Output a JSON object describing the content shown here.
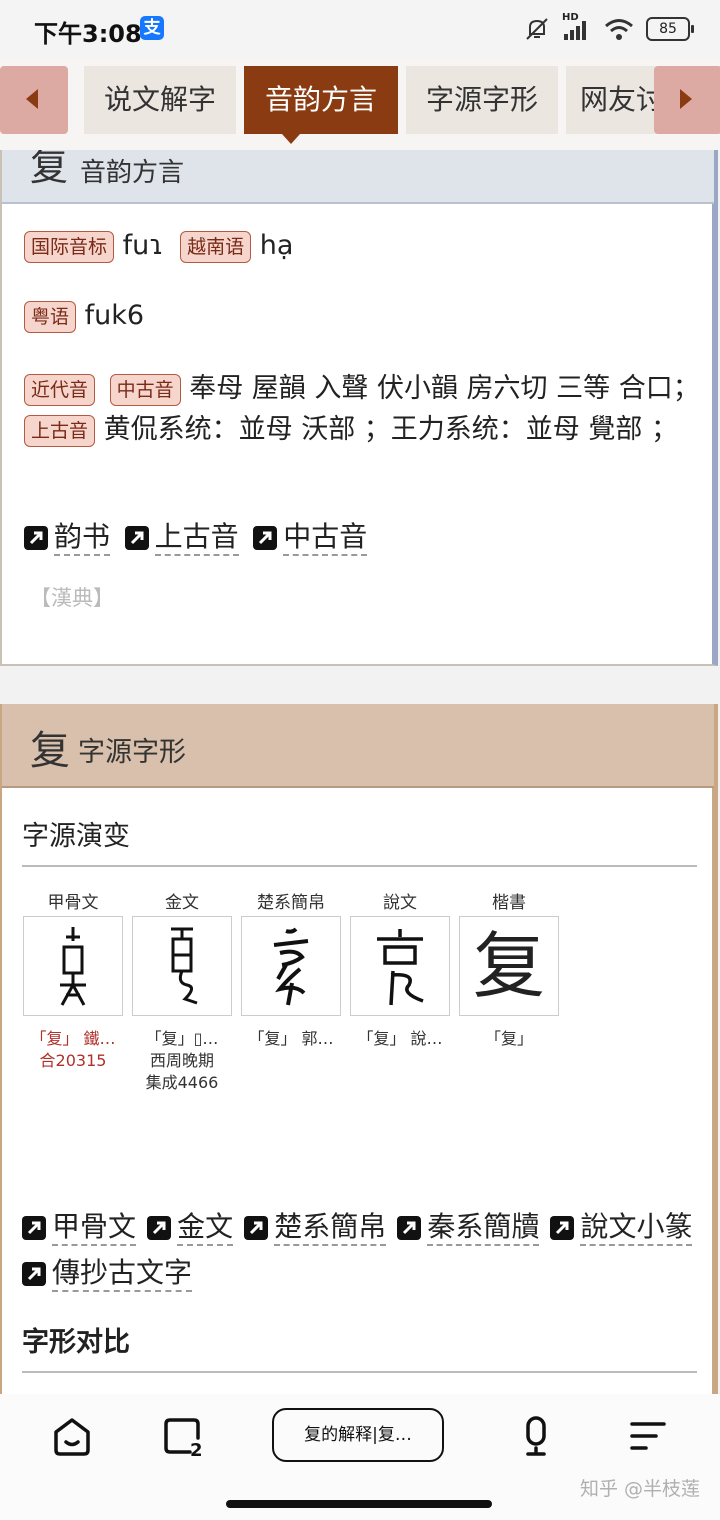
{
  "status": {
    "time": "下午3:08",
    "alipay_glyph": "支",
    "battery": "85",
    "hd": "HD"
  },
  "tabs": [
    {
      "label": "说文解字",
      "active": false
    },
    {
      "label": "音韵方言",
      "active": true
    },
    {
      "label": "字源字形",
      "active": false
    },
    {
      "label": "网友讨",
      "active": false
    }
  ],
  "section1": {
    "char": "复",
    "title": "音韵方言",
    "ipa_badge": "国际音标",
    "ipa_value": "fuɿ",
    "viet_badge": "越南语",
    "viet_value": "hạ",
    "yue_badge": "粤语",
    "yue_value": "fuk6",
    "modern_badge": "近代音",
    "middle_badge": "中古音",
    "middle_text_1": "奉母 屋韻 入聲 伏小韻 房六切 三等",
    "middle_text_2": "合口；",
    "old_badge": "上古音",
    "old_text": "黄侃系统：並母 沃部 ；王力系统：並母 覺部 ；",
    "links": [
      "韵书",
      "上古音",
      "中古音"
    ],
    "source": "【漢典】"
  },
  "section2": {
    "char": "复",
    "title": "字源字形",
    "evolution_title": "字源演变",
    "glyphs": [
      {
        "label": "甲骨文",
        "caption": "「复」 鐵…",
        "caption2": "合20315",
        "red": true
      },
      {
        "label": "金文",
        "caption": "「复」▯…",
        "caption2": "西周晚期",
        "caption3": "集成4466",
        "red": false
      },
      {
        "label": "楚系簡帛",
        "caption": "「复」 郭…",
        "red": false
      },
      {
        "label": "說文",
        "caption": "「复」 說…",
        "red": false
      },
      {
        "label": "楷書",
        "caption": "「复」",
        "kaishu": "复",
        "red": false
      }
    ],
    "links": [
      "甲骨文",
      "金文",
      "楚系簡帛",
      "秦系簡牘",
      "說文小篆",
      "傳抄古文字"
    ],
    "compare_title": "字形对比"
  },
  "bottom": {
    "search_text": "复的解释|复…",
    "watermark": "知乎 @半枝莲"
  },
  "colors": {
    "accent": "#8a3b12",
    "badge_bg": "#f6d6cc",
    "header_blue": "#dfe3ea",
    "header_tan": "#d9c0ad"
  }
}
